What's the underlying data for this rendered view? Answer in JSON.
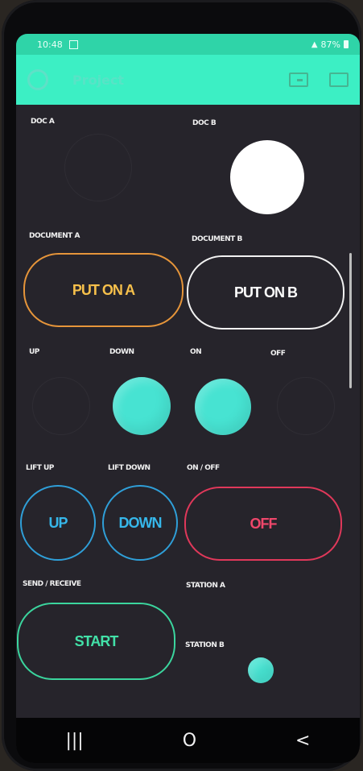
{
  "status": {
    "time": "10:48",
    "battery": "87%"
  },
  "appbar": {
    "title": "Project"
  },
  "doc_a": {
    "label": "DOC A",
    "led": "off"
  },
  "doc_b": {
    "label": "DOC B",
    "led": "on",
    "color": "#ffffff"
  },
  "document_a": {
    "label": "DOCUMENT A",
    "button": "PUT ON A",
    "color": "#e6953a"
  },
  "document_b": {
    "label": "DOCUMENT B",
    "button": "PUT ON B",
    "color": "#f2f2f2"
  },
  "leds": [
    {
      "label": "UP",
      "state": "off"
    },
    {
      "label": "DOWN",
      "state": "on"
    },
    {
      "label": "ON",
      "state": "on"
    },
    {
      "label": "OFF",
      "state": "off"
    }
  ],
  "lift_up": {
    "label": "LIFT UP",
    "button": "UP",
    "color": "#2f9fd8"
  },
  "lift_down": {
    "label": "LIFT DOWN",
    "button": "DOWN",
    "color": "#2f9fd8"
  },
  "on_off": {
    "label": "ON / OFF",
    "button": "OFF",
    "color": "#e0385a"
  },
  "send_receive": {
    "label": "SEND / RECEIVE",
    "button": "START",
    "color": "#3bd59e"
  },
  "station_a": {
    "label": "STATION A"
  },
  "station_b": {
    "label": "STATION B",
    "led": "on"
  },
  "colors": {
    "accent": "#3cefc4",
    "led_on": "#47e3d2"
  },
  "nav": {
    "recents": "|||",
    "home": "O",
    "back": "<"
  }
}
